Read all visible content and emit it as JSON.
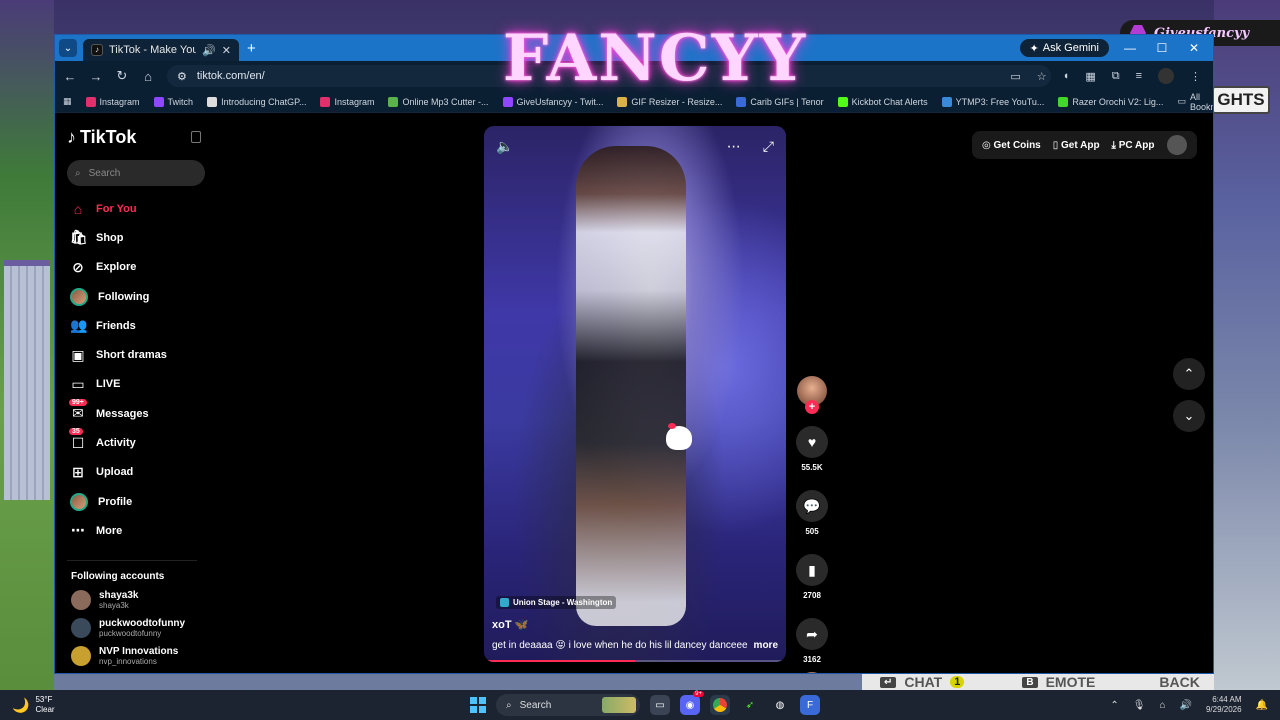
{
  "overlay": {
    "streamer_name": "Giveusfancyy",
    "logo_text": "FANCYY",
    "lights_sign": "GHTS",
    "hud": {
      "chat_label": "CHAT",
      "chat_key": "↵",
      "chat_count": "1",
      "emote_key": "B",
      "emote_label": "EMOTE",
      "back_label": "BACK"
    }
  },
  "browser": {
    "tab_title": "TikTok - Make Your Day",
    "ask_gemini": "Ask Gemini",
    "url": "tiktok.com/en/",
    "bookmarks": [
      {
        "label": "Instagram",
        "color": "#e1306c"
      },
      {
        "label": "Twitch",
        "color": "#9146ff"
      },
      {
        "label": "Introducing ChatGP...",
        "color": "#dddddd"
      },
      {
        "label": "Instagram",
        "color": "#e1306c"
      },
      {
        "label": "Online Mp3 Cutter -...",
        "color": "#5ab44a"
      },
      {
        "label": "GiveUsfancyy - Twit...",
        "color": "#9146ff"
      },
      {
        "label": "GIF Resizer - Resize...",
        "color": "#d8b24a"
      },
      {
        "label": "Carib GIFs | Tenor",
        "color": "#3a6ad8"
      },
      {
        "label": "Kickbot Chat Alerts",
        "color": "#53fc18"
      },
      {
        "label": "YTMP3: Free YouTu...",
        "color": "#3a8ad8"
      },
      {
        "label": "Razer Orochi V2: Lig...",
        "color": "#44d62c"
      }
    ],
    "all_bookmarks": "All Bookmarks"
  },
  "tiktok": {
    "brand": "TikTok",
    "search_placeholder": "Search",
    "nav": [
      {
        "label": "For You",
        "icon": "home-icon",
        "glyph": "⌂",
        "active": true
      },
      {
        "label": "Shop",
        "icon": "shopping-bag-icon",
        "glyph": "🛍"
      },
      {
        "label": "Explore",
        "icon": "compass-icon",
        "glyph": "⊘"
      },
      {
        "label": "Following",
        "icon": "following-avatar",
        "glyph": ""
      },
      {
        "label": "Friends",
        "icon": "friends-icon",
        "glyph": "👥"
      },
      {
        "label": "Short dramas",
        "icon": "film-icon",
        "glyph": "▣"
      },
      {
        "label": "LIVE",
        "icon": "live-icon",
        "glyph": "▭"
      },
      {
        "label": "Messages",
        "icon": "messages-icon",
        "glyph": "✉",
        "badge": "99+"
      },
      {
        "label": "Activity",
        "icon": "activity-icon",
        "glyph": "☐",
        "badge": "35"
      },
      {
        "label": "Upload",
        "icon": "upload-icon",
        "glyph": "⊞"
      },
      {
        "label": "Profile",
        "icon": "profile-avatar",
        "glyph": ""
      },
      {
        "label": "More",
        "icon": "more-icon",
        "glyph": "⋯"
      }
    ],
    "following_title": "Following accounts",
    "accounts": [
      {
        "name": "shaya3k",
        "handle": "shaya3k",
        "color": "#8a6a5a"
      },
      {
        "name": "puckwoodtofunny",
        "handle": "puckwoodtofunny",
        "color": "#3a4a5a"
      },
      {
        "name": "NVP Innovations",
        "handle": "nvp_innovations",
        "color": "#c8a030"
      }
    ],
    "top_actions": {
      "coins": "Get Coins",
      "app": "Get App",
      "pc": "PC App"
    },
    "video": {
      "location": "Union Stage - Washington",
      "author": "xoT 🦋",
      "caption": "get in deaaaa 😝 i love when he do his lil dancey danceee",
      "more": "more",
      "progress": 0.5
    },
    "rail": {
      "likes": "55.5K",
      "comments": "505",
      "saves": "2708",
      "shares": "3162"
    }
  },
  "taskbar": {
    "temp": "53°F",
    "condition": "Clear",
    "search": "Search",
    "discord_badge": "9+",
    "time": "6:44 AM",
    "date": "9/29/2026"
  }
}
